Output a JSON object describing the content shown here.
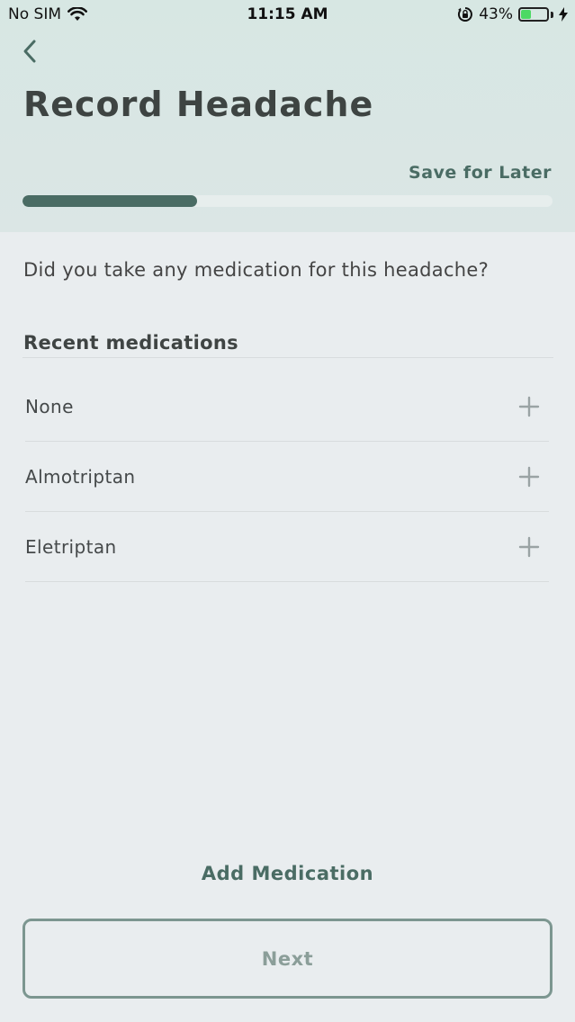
{
  "status_bar": {
    "carrier": "No SIM",
    "time": "11:15 AM",
    "battery_percent": "43%",
    "battery_level": 0.43
  },
  "header": {
    "title": "Record Headache",
    "save_label": "Save for Later",
    "progress": 0.33
  },
  "question": "Did you take any medication for this headache?",
  "recent": {
    "title": "Recent medications",
    "items": [
      {
        "label": "None"
      },
      {
        "label": "Almotriptan"
      },
      {
        "label": "Eletriptan"
      }
    ]
  },
  "actions": {
    "add_medication": "Add Medication",
    "next": "Next"
  },
  "colors": {
    "accent": "#4a6c64",
    "header_bg": "#d9e7e4",
    "page_bg": "#e9edef"
  }
}
